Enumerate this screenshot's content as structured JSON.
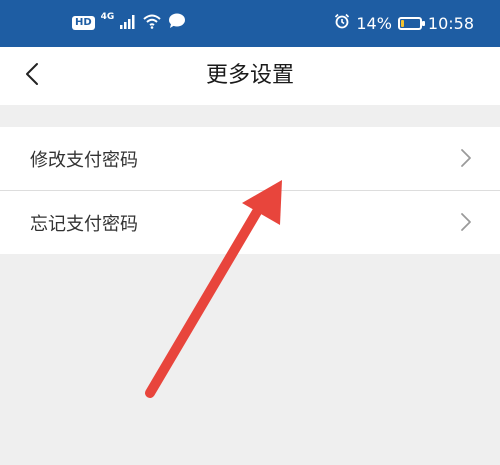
{
  "status_bar": {
    "hd_badge": "HD",
    "network": "4G",
    "battery_level_percent": 14,
    "battery": "14%",
    "time": "10:58",
    "icons": [
      "signal-icon",
      "wifi-icon",
      "chat-bubble-icon",
      "alarm-icon",
      "battery-icon"
    ]
  },
  "nav": {
    "back_icon": "chevron-left-icon",
    "title": "更多设置"
  },
  "menu": {
    "items": [
      {
        "label": "修改支付密码",
        "icon": "chevron-right-icon"
      },
      {
        "label": "忘记支付密码",
        "icon": "chevron-right-icon"
      }
    ]
  },
  "annotation": {
    "icon": "red-arrow-annotation",
    "color": "#e8453c"
  },
  "colors": {
    "status_bar_bg": "#1e5da3",
    "page_bg": "#efefef",
    "card_bg": "#ffffff"
  }
}
